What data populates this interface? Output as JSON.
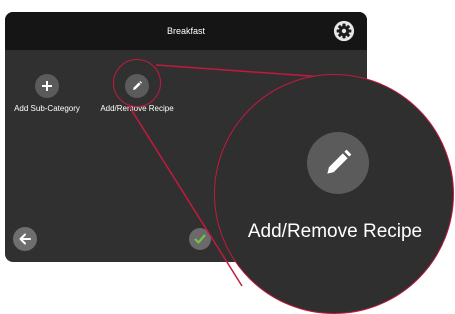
{
  "header": {
    "title": "Breakfast",
    "settings_icon": "gear-icon"
  },
  "tiles": [
    {
      "label": "Add Sub-Category",
      "icon": "plus-icon"
    },
    {
      "label": "Add/Remove Recipe",
      "icon": "pencil-icon"
    }
  ],
  "footer": {
    "back_icon": "arrow-left-icon",
    "confirm_icon": "check-icon"
  },
  "callout": {
    "label": "Add/Remove Recipe",
    "icon": "pencil-icon"
  },
  "colors": {
    "titlebar": "#151515",
    "screen": "#303030",
    "icon_circle": "#5b5b5b",
    "callout_accent": "#c21a3d",
    "confirm_check": "#7ac143"
  }
}
